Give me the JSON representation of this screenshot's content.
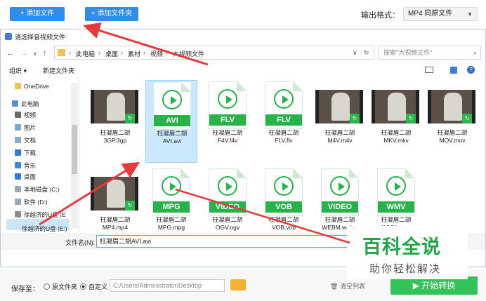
{
  "toolbar": {
    "add_file": "+ 添加文件",
    "add_folder": "+ 添加文件夹",
    "format_label": "输出格式：",
    "format_value": "MP4 同原文件"
  },
  "dialog": {
    "title": "请选择音视频文件",
    "breadcrumb": [
      "此电脑",
      "桌面",
      "素材",
      "视频",
      "大视频文件"
    ],
    "search_placeholder": "搜索\"大视频文件\"",
    "organize": "组织 ▾",
    "new_folder": "新建文件夹",
    "sidebar": [
      "OneDrive",
      "此电脑",
      "视频",
      "图片",
      "文档",
      "下载",
      "音乐",
      "桌面",
      "本地磁盘 (C:)",
      "软件 (D:)",
      "徐越济的U盘 (E",
      "徐越济的U盘 (E:)"
    ],
    "files": [
      {
        "label": "枉凝眉二胡",
        "file": "3GP.3gp",
        "kind": "video"
      },
      {
        "label": "枉凝眉二胡",
        "file": "AVI.avi",
        "kind": "doc",
        "tag": "AVI",
        "selected": true
      },
      {
        "label": "枉凝眉二胡",
        "file": "F4V.f4v",
        "kind": "doc",
        "tag": "FLV"
      },
      {
        "label": "枉凝眉二胡",
        "file": "FLV.flv",
        "kind": "doc",
        "tag": "FLV"
      },
      {
        "label": "枉凝眉二胡",
        "file": "M4V.m4v",
        "kind": "video"
      },
      {
        "label": "枉凝眉二胡",
        "file": "MKV.mkv",
        "kind": "video"
      },
      {
        "label": "枉凝眉二胡",
        "file": "MOV.mov",
        "kind": "video"
      },
      {
        "label": "枉凝眉二胡",
        "file": "MP4.mp4",
        "kind": "video"
      },
      {
        "label": "枉凝眉二胡",
        "file": "MPG.mpg",
        "kind": "doc",
        "tag": "MPG"
      },
      {
        "label": "枉凝眉二胡",
        "file": "OGV.ogv",
        "kind": "doc",
        "tag": "VIDEO"
      },
      {
        "label": "枉凝眉二胡",
        "file": "VOB.vob",
        "kind": "doc",
        "tag": "VOB"
      },
      {
        "label": "枉凝眉二胡",
        "file": "WEBM.webm",
        "kind": "doc",
        "tag": "VIDEO"
      },
      {
        "label": "枉凝眉二胡",
        "file": "WMV.wmv",
        "kind": "doc",
        "tag": "WMV"
      }
    ],
    "filename_label": "文件名(N):",
    "filename_value": "枉凝眉二胡AVI.avi"
  },
  "bottom": {
    "save_to": "保存至：",
    "radio_original": "原文件夹",
    "radio_custom": "自定义",
    "path": "C:/Users/Administrator/Desktop",
    "clear_list": "清空列表",
    "start": "开始转换"
  },
  "watermark": {
    "big": "百科全说",
    "small": "助你轻松解决"
  },
  "colors": {
    "accent": "#2f8ce8",
    "green": "#27b24a",
    "arrow": "#e83a3a"
  }
}
